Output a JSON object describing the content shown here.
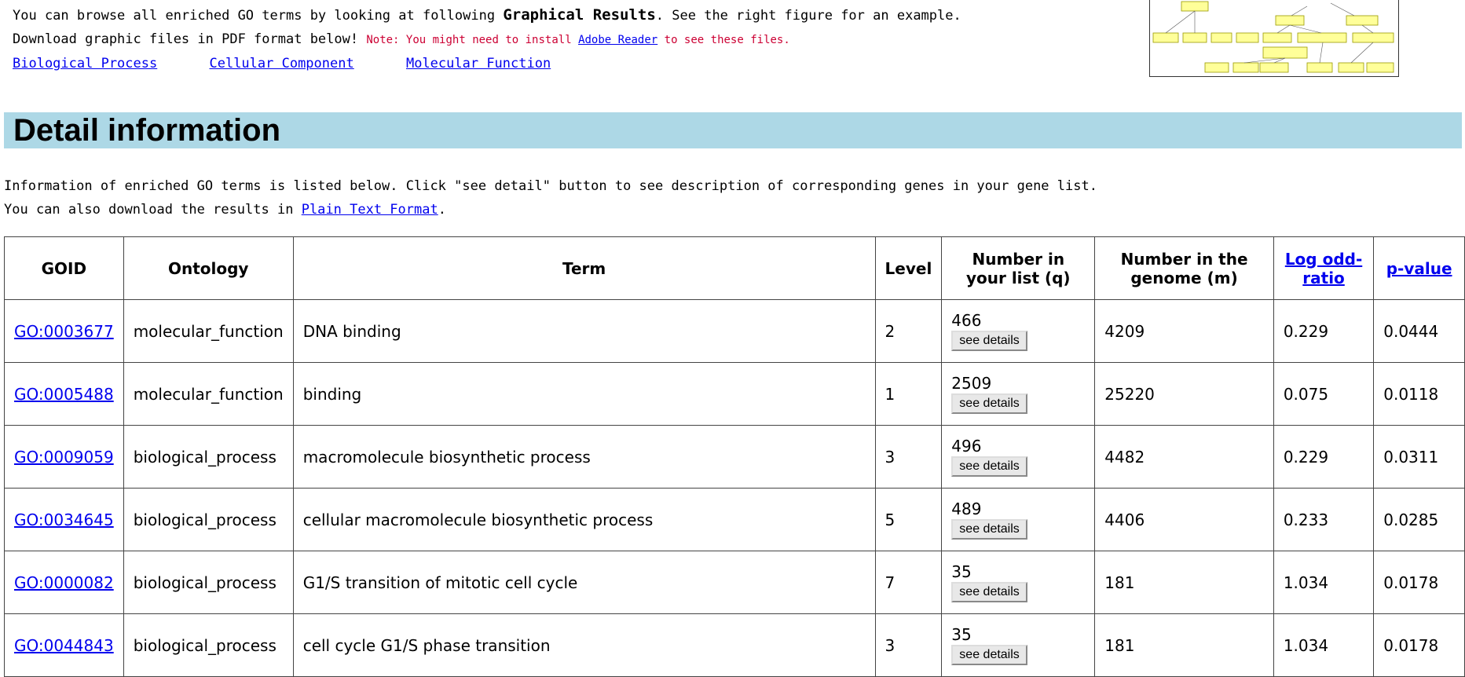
{
  "intro": {
    "line1_before": "You can browse all enriched GO terms by looking at following ",
    "line1_bold": "Graphical Results",
    "line1_after": ". See the right figure for an example.",
    "line2_text": "Download graphic files in PDF format below! ",
    "note_before": "Note: You might need to install ",
    "note_link": "Adobe Reader",
    "note_after": " to see these files.",
    "links": [
      "Biological Process",
      "Cellular Component",
      "Molecular Function"
    ]
  },
  "detail": {
    "title": "Detail information",
    "line1": "Information of enriched GO terms is listed below. Click \"see detail\" button to see description of corresponding genes in your gene list.",
    "line2_before": "You can also download the results in ",
    "line2_link": "Plain Text Format",
    "line2_after": "."
  },
  "table": {
    "headers": [
      "GOID",
      "Ontology",
      "Term",
      "Level",
      "Number in your list (q)",
      "Number in the genome (m)",
      "Log odd-ratio",
      "p-value"
    ],
    "button_label": "see details",
    "rows": [
      {
        "goid": "GO:0003677",
        "ontology": "molecular_function",
        "term": "DNA binding",
        "level": "2",
        "q": "466",
        "m": "4209",
        "log_odd": "0.229",
        "pvalue": "0.0444"
      },
      {
        "goid": "GO:0005488",
        "ontology": "molecular_function",
        "term": "binding",
        "level": "1",
        "q": "2509",
        "m": "25220",
        "log_odd": "0.075",
        "pvalue": "0.0118"
      },
      {
        "goid": "GO:0009059",
        "ontology": "biological_process",
        "term": "macromolecule biosynthetic process",
        "level": "3",
        "q": "496",
        "m": "4482",
        "log_odd": "0.229",
        "pvalue": "0.0311"
      },
      {
        "goid": "GO:0034645",
        "ontology": "biological_process",
        "term": "cellular macromolecule biosynthetic process",
        "level": "5",
        "q": "489",
        "m": "4406",
        "log_odd": "0.233",
        "pvalue": "0.0285"
      },
      {
        "goid": "GO:0000082",
        "ontology": "biological_process",
        "term": "G1/S transition of mitotic cell cycle",
        "level": "7",
        "q": "35",
        "m": "181",
        "log_odd": "1.034",
        "pvalue": "0.0178"
      },
      {
        "goid": "GO:0044843",
        "ontology": "biological_process",
        "term": "cell cycle G1/S phase transition",
        "level": "3",
        "q": "35",
        "m": "181",
        "log_odd": "1.034",
        "pvalue": "0.0178"
      }
    ]
  },
  "colors": {
    "header_bar": "#add8e6",
    "link": "#0000ee",
    "note": "#cc0033"
  }
}
